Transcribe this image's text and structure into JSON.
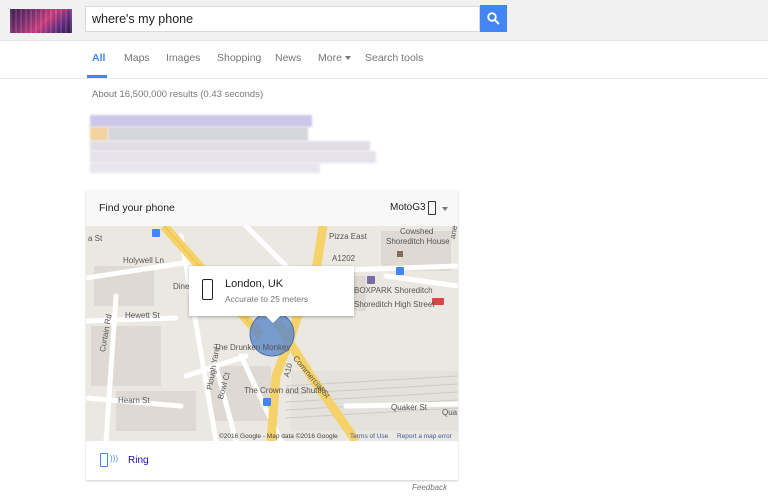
{
  "search": {
    "query": "where's my phone"
  },
  "tabs": [
    {
      "label": "All",
      "active": true
    },
    {
      "label": "Maps"
    },
    {
      "label": "Images"
    },
    {
      "label": "Shopping"
    },
    {
      "label": "News"
    },
    {
      "label": "More"
    },
    {
      "label": "Search tools"
    }
  ],
  "results": {
    "stats": "About 16,500,000 results (0.43 seconds)"
  },
  "card": {
    "title": "Find your phone",
    "device": "MotoG3",
    "popup": {
      "location": "London, UK",
      "accuracy": "Accurate to 25 meters"
    },
    "ring_label": "Ring",
    "map_labels": {
      "holywell": "Holywell Ln",
      "hewett": "Hewett St",
      "curtain": "Curtain Rd",
      "pizza": "Pizza East",
      "cowshed": "Cowshed",
      "cowshed2": "Shoreditch House",
      "boxpark": "BOXPARK Shoreditch",
      "station": "Shoreditch High Street",
      "drunken": "The Drunken Monkey",
      "commercial": "Commercial St",
      "plough": "Plough Yard",
      "bowl": "Bowl Ct",
      "crown": "The Crown and Shuttle",
      "hearn": "Hearn St",
      "quaker": "Quaker St",
      "a10": "A10",
      "a1202": "A1202",
      "dine": "Dine",
      "sa": "a St",
      "ane": "ane",
      "qua": "Qua"
    },
    "map_credits": {
      "data": "©2016 Google - Map data ©2016 Google",
      "terms": "Terms of Use",
      "report": "Report a map error"
    }
  },
  "footer": {
    "feedback": "Feedback"
  },
  "colors": {
    "accent": "#4285f4",
    "link": "#1a0dab",
    "road_major": "#f6d36a",
    "location_dot": "#5b87c9"
  }
}
